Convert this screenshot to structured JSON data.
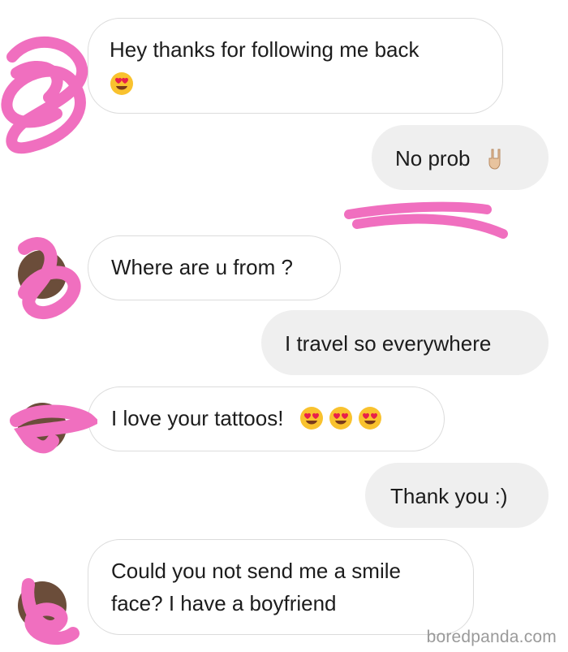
{
  "messages": [
    {
      "sender": "them",
      "text": "Hey thanks for following me back",
      "emoji": [
        "heart-eyes"
      ]
    },
    {
      "sender": "me",
      "text": "No prob",
      "emoji": [
        "rock-on"
      ]
    },
    {
      "sender": "them",
      "text": "Where are u from ?",
      "emoji": []
    },
    {
      "sender": "me",
      "text": "I travel so everywhere",
      "emoji": []
    },
    {
      "sender": "them",
      "text": "I love your tattoos!",
      "emoji": [
        "heart-eyes",
        "heart-eyes",
        "heart-eyes"
      ]
    },
    {
      "sender": "me",
      "text": "Thank you :)",
      "emoji": []
    },
    {
      "sender": "them",
      "text_lines": [
        "Could you not send me a smile",
        "face?  I have a boyfriend"
      ],
      "emoji": []
    }
  ],
  "watermark": "boredpanda.com",
  "colors": {
    "incoming_bubble": "#ffffff",
    "outgoing_bubble": "#efefef",
    "bubble_border": "#dcdcdc",
    "redaction": "#f06fbf",
    "text": "#1c1c1c"
  }
}
